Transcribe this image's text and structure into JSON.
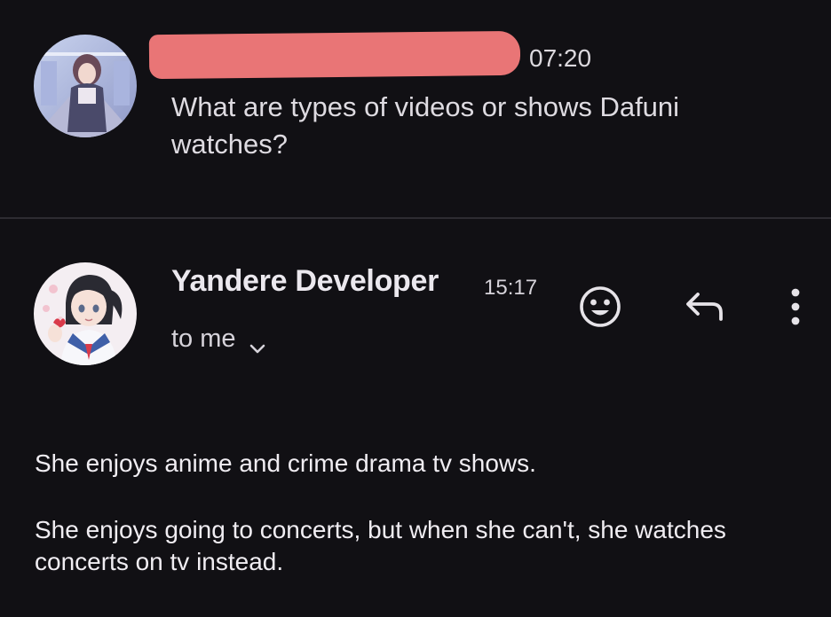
{
  "message_1": {
    "avatar_icon": "anime-girl-hallway-avatar-icon",
    "time": "07:20",
    "snippet": "What are types of videos or shows Dafuni watches?"
  },
  "message_2": {
    "avatar_icon": "anime-schoolgirl-avatar-icon",
    "sender": "Yandere Developer",
    "time": "15:17",
    "recipient": "to me",
    "actions": {
      "react_icon": "smiley-icon",
      "reply_icon": "reply-arrow-icon",
      "more_icon": "more-vertical-icon"
    },
    "body": [
      "She enjoys anime and crime drama tv shows.",
      "She enjoys going to concerts, but when she can't, she watches concerts on tv instead."
    ]
  },
  "colors": {
    "background": "#111014",
    "redaction": "#e97576",
    "text_primary": "#f0edf2",
    "divider": "#2e2c32"
  }
}
